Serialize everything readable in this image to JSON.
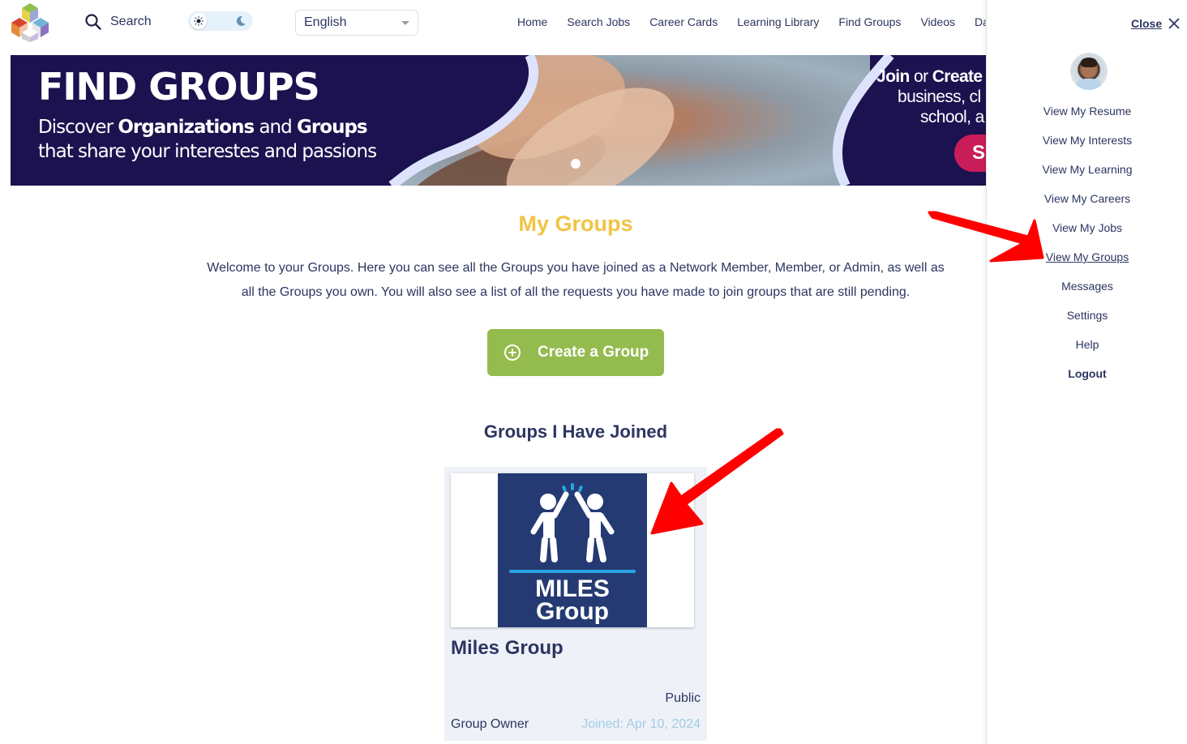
{
  "header": {
    "search_label": "Search",
    "language": {
      "selected": "English"
    },
    "theme_toggle": {
      "mode": "light"
    },
    "nav": [
      {
        "label": "Home"
      },
      {
        "label": "Search Jobs"
      },
      {
        "label": "Career Cards"
      },
      {
        "label": "Learning Library"
      },
      {
        "label": "Find Groups"
      },
      {
        "label": "Videos"
      },
      {
        "label": "Das"
      }
    ]
  },
  "banner": {
    "title": "FIND GROUPS",
    "line1_pre": "Discover ",
    "line1_b1": "Organizations",
    "line1_mid": " and ",
    "line1_b2": "Groups",
    "line2": "that share your interestes and passions",
    "right_b1": "Join",
    "right_mid": " or ",
    "right_b2": "Create",
    "right_l2": "business, cl",
    "right_l3": "school, a",
    "cta_label": "S",
    "slide_index": 1,
    "slide_count": 1
  },
  "main": {
    "title": "My Groups",
    "intro": "Welcome to your Groups. Here you can see all the Groups you have joined as a Network Member, Member, or Admin, as well as all the Groups you own. You will also see a list of all the requests you have made to join groups that are still pending.",
    "create_button": "Create a Group",
    "joined_section_title": "Groups I Have Joined",
    "groups": [
      {
        "logo_line1": "MILES",
        "logo_line2": "Group",
        "name": "Miles Group",
        "visibility": "Public",
        "role": "Group Owner",
        "joined": "Joined: Apr 10, 2024"
      }
    ]
  },
  "side_panel": {
    "close_label": "Close",
    "menu": [
      {
        "label": "View My Resume"
      },
      {
        "label": "View My Interests"
      },
      {
        "label": "View My Learning"
      },
      {
        "label": "View My Careers"
      },
      {
        "label": "View My Jobs"
      },
      {
        "label": "View My Groups",
        "active": true
      },
      {
        "label": "Messages"
      },
      {
        "label": "Settings"
      },
      {
        "label": "Help"
      },
      {
        "label": "Logout"
      }
    ]
  },
  "colors": {
    "primary_text": "#2d3561",
    "title_yellow": "#f0c444",
    "create_green": "#94bb4d",
    "banner_navy": "#1c1250",
    "cta_pink": "#c81d59",
    "joined_blue": "#a3cbe3",
    "group_logo_bg": "#253a72",
    "annotation_red": "#ff0000"
  }
}
